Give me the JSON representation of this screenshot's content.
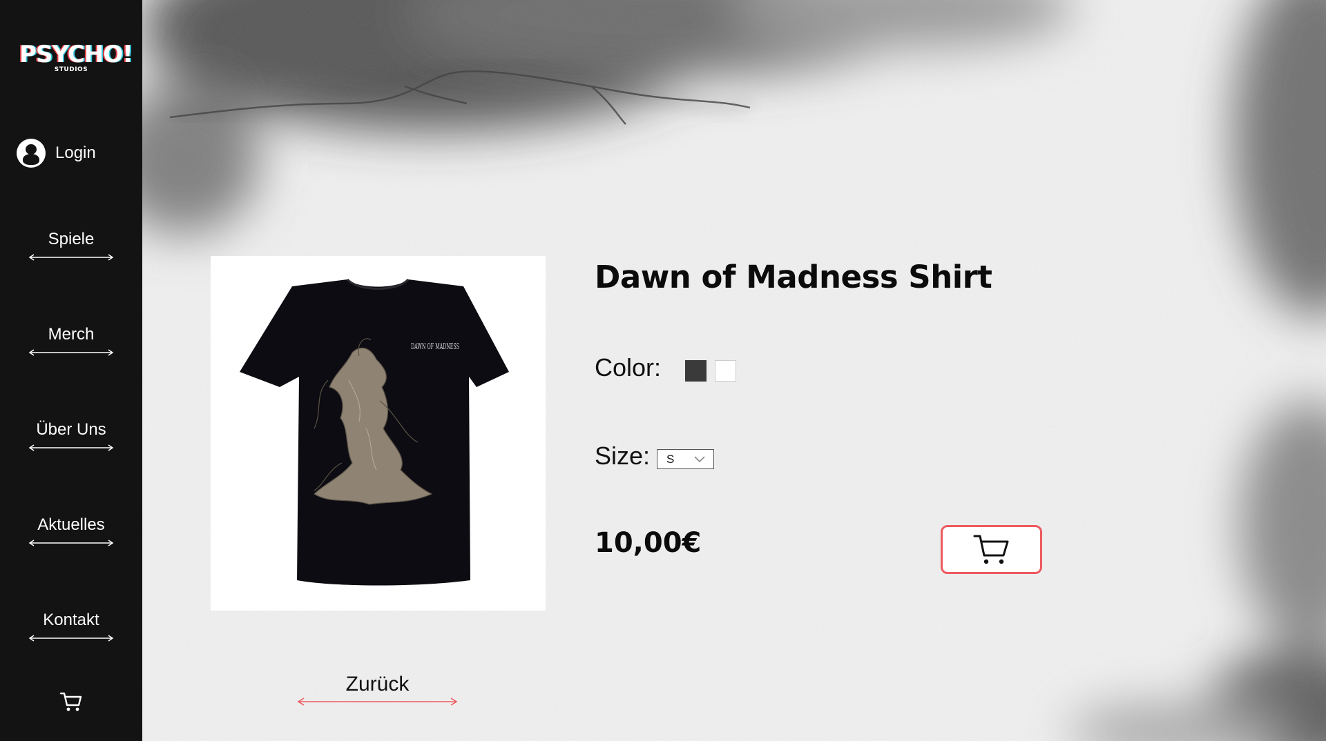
{
  "brand": {
    "name": "PSYCHO!",
    "sub": "STUDIOS"
  },
  "sidebar": {
    "login_label": "Login",
    "nav": [
      {
        "label": "Spiele"
      },
      {
        "label": "Merch"
      },
      {
        "label": "Über Uns"
      },
      {
        "label": "Aktuelles"
      },
      {
        "label": "Kontakt"
      }
    ],
    "cart_icon": "cart-icon"
  },
  "product": {
    "title": "Dawn of Madness Shirt",
    "color_label": "Color:",
    "colors": [
      "#3a3a3a",
      "#ffffff"
    ],
    "size_label": "Size:",
    "size_value": "S",
    "price": "10,00€",
    "print_text": "DAWN OF MADNESS"
  },
  "back_label": "Zurück",
  "colors": {
    "sidebar": "#131313",
    "accent": "#ee5a5f",
    "page": "#f1f1f1"
  }
}
